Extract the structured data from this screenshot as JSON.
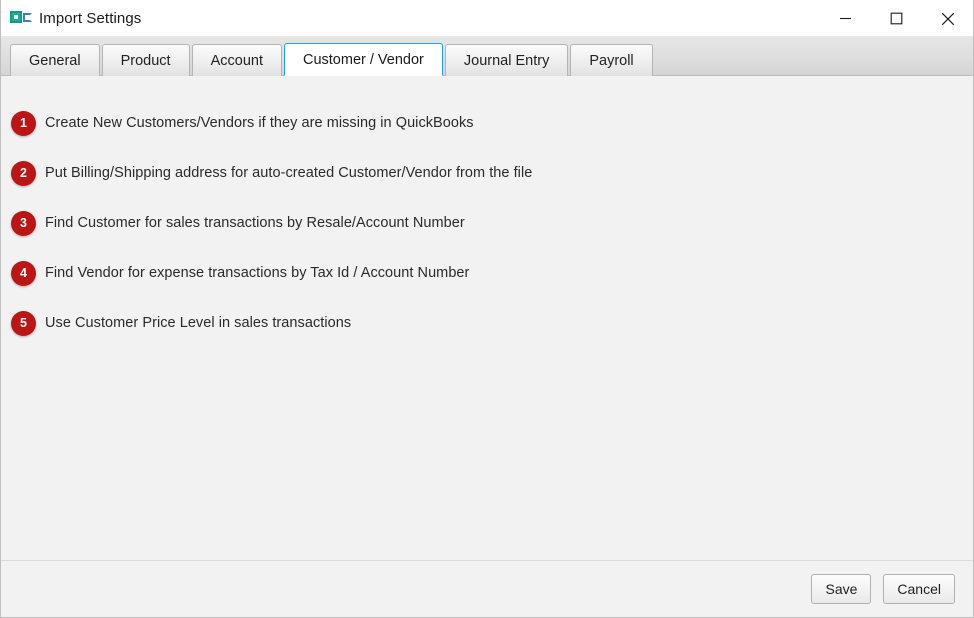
{
  "window": {
    "title": "Import Settings",
    "icon": "app-sheet-icon",
    "controls": {
      "minimize": "minimize-icon",
      "maximize": "maximize-icon",
      "close": "close-icon"
    }
  },
  "tabs": [
    {
      "label": "General",
      "selected": false
    },
    {
      "label": "Product",
      "selected": false
    },
    {
      "label": "Account",
      "selected": false
    },
    {
      "label": "Customer / Vendor",
      "selected": true
    },
    {
      "label": "Journal Entry",
      "selected": false
    },
    {
      "label": "Payroll",
      "selected": false
    }
  ],
  "options": [
    {
      "number": "1",
      "label": "Create New Customers/Vendors if they are missing in QuickBooks"
    },
    {
      "number": "2",
      "label": "Put Billing/Shipping address for auto-created Customer/Vendor from the file"
    },
    {
      "number": "3",
      "label": "Find Customer for sales transactions by Resale/Account Number"
    },
    {
      "number": "4",
      "label": "Find Vendor for expense transactions by Tax Id / Account Number"
    },
    {
      "number": "5",
      "label": "Use Customer Price Level in sales transactions"
    }
  ],
  "footer": {
    "save_label": "Save",
    "cancel_label": "Cancel"
  },
  "colors": {
    "badge_red": "#bb1515",
    "selected_tab_border": "#1ea3e0",
    "content_background": "#f2f2f2",
    "icon_green": "#16b39a",
    "icon_blue": "#3a7fc1"
  }
}
